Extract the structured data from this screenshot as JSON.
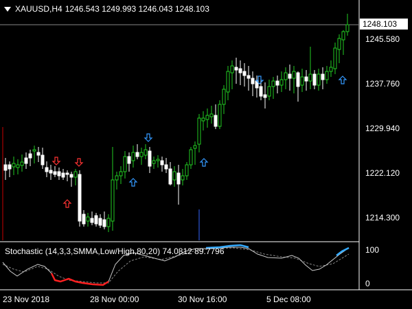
{
  "header": {
    "symbol_tf": "XAUUSD,H4",
    "ohlc": "1246.543 1249.993 1246.043 1248.103"
  },
  "price_axis": {
    "current": "1248.103",
    "ticks": [
      "1245.580",
      "1237.760",
      "1229.940",
      "1222.120",
      "1214.300"
    ]
  },
  "indicator": {
    "title": "Stochastic (14,3,3,SMMA,Low/High,80,20) 74.0812 89.7796",
    "ticks": [
      "100",
      "0"
    ]
  },
  "time_axis": [
    "23 Nov 2018",
    "28 Nov 00:00",
    "30 Nov 16:00",
    "5 Dec 08:00"
  ],
  "colors": {
    "background": "#000000",
    "bull_candle": "#22cc22",
    "bear_candle": "#ffffff",
    "up_arrow": "#3399ff",
    "down_arrow": "#3399ff",
    "sell_arrow": "#ff3333",
    "stoch_main": "#cccccc",
    "stoch_signal": "#888888",
    "stoch_oversold": "#ff2020",
    "stoch_overbought": "#33aaff"
  }
}
